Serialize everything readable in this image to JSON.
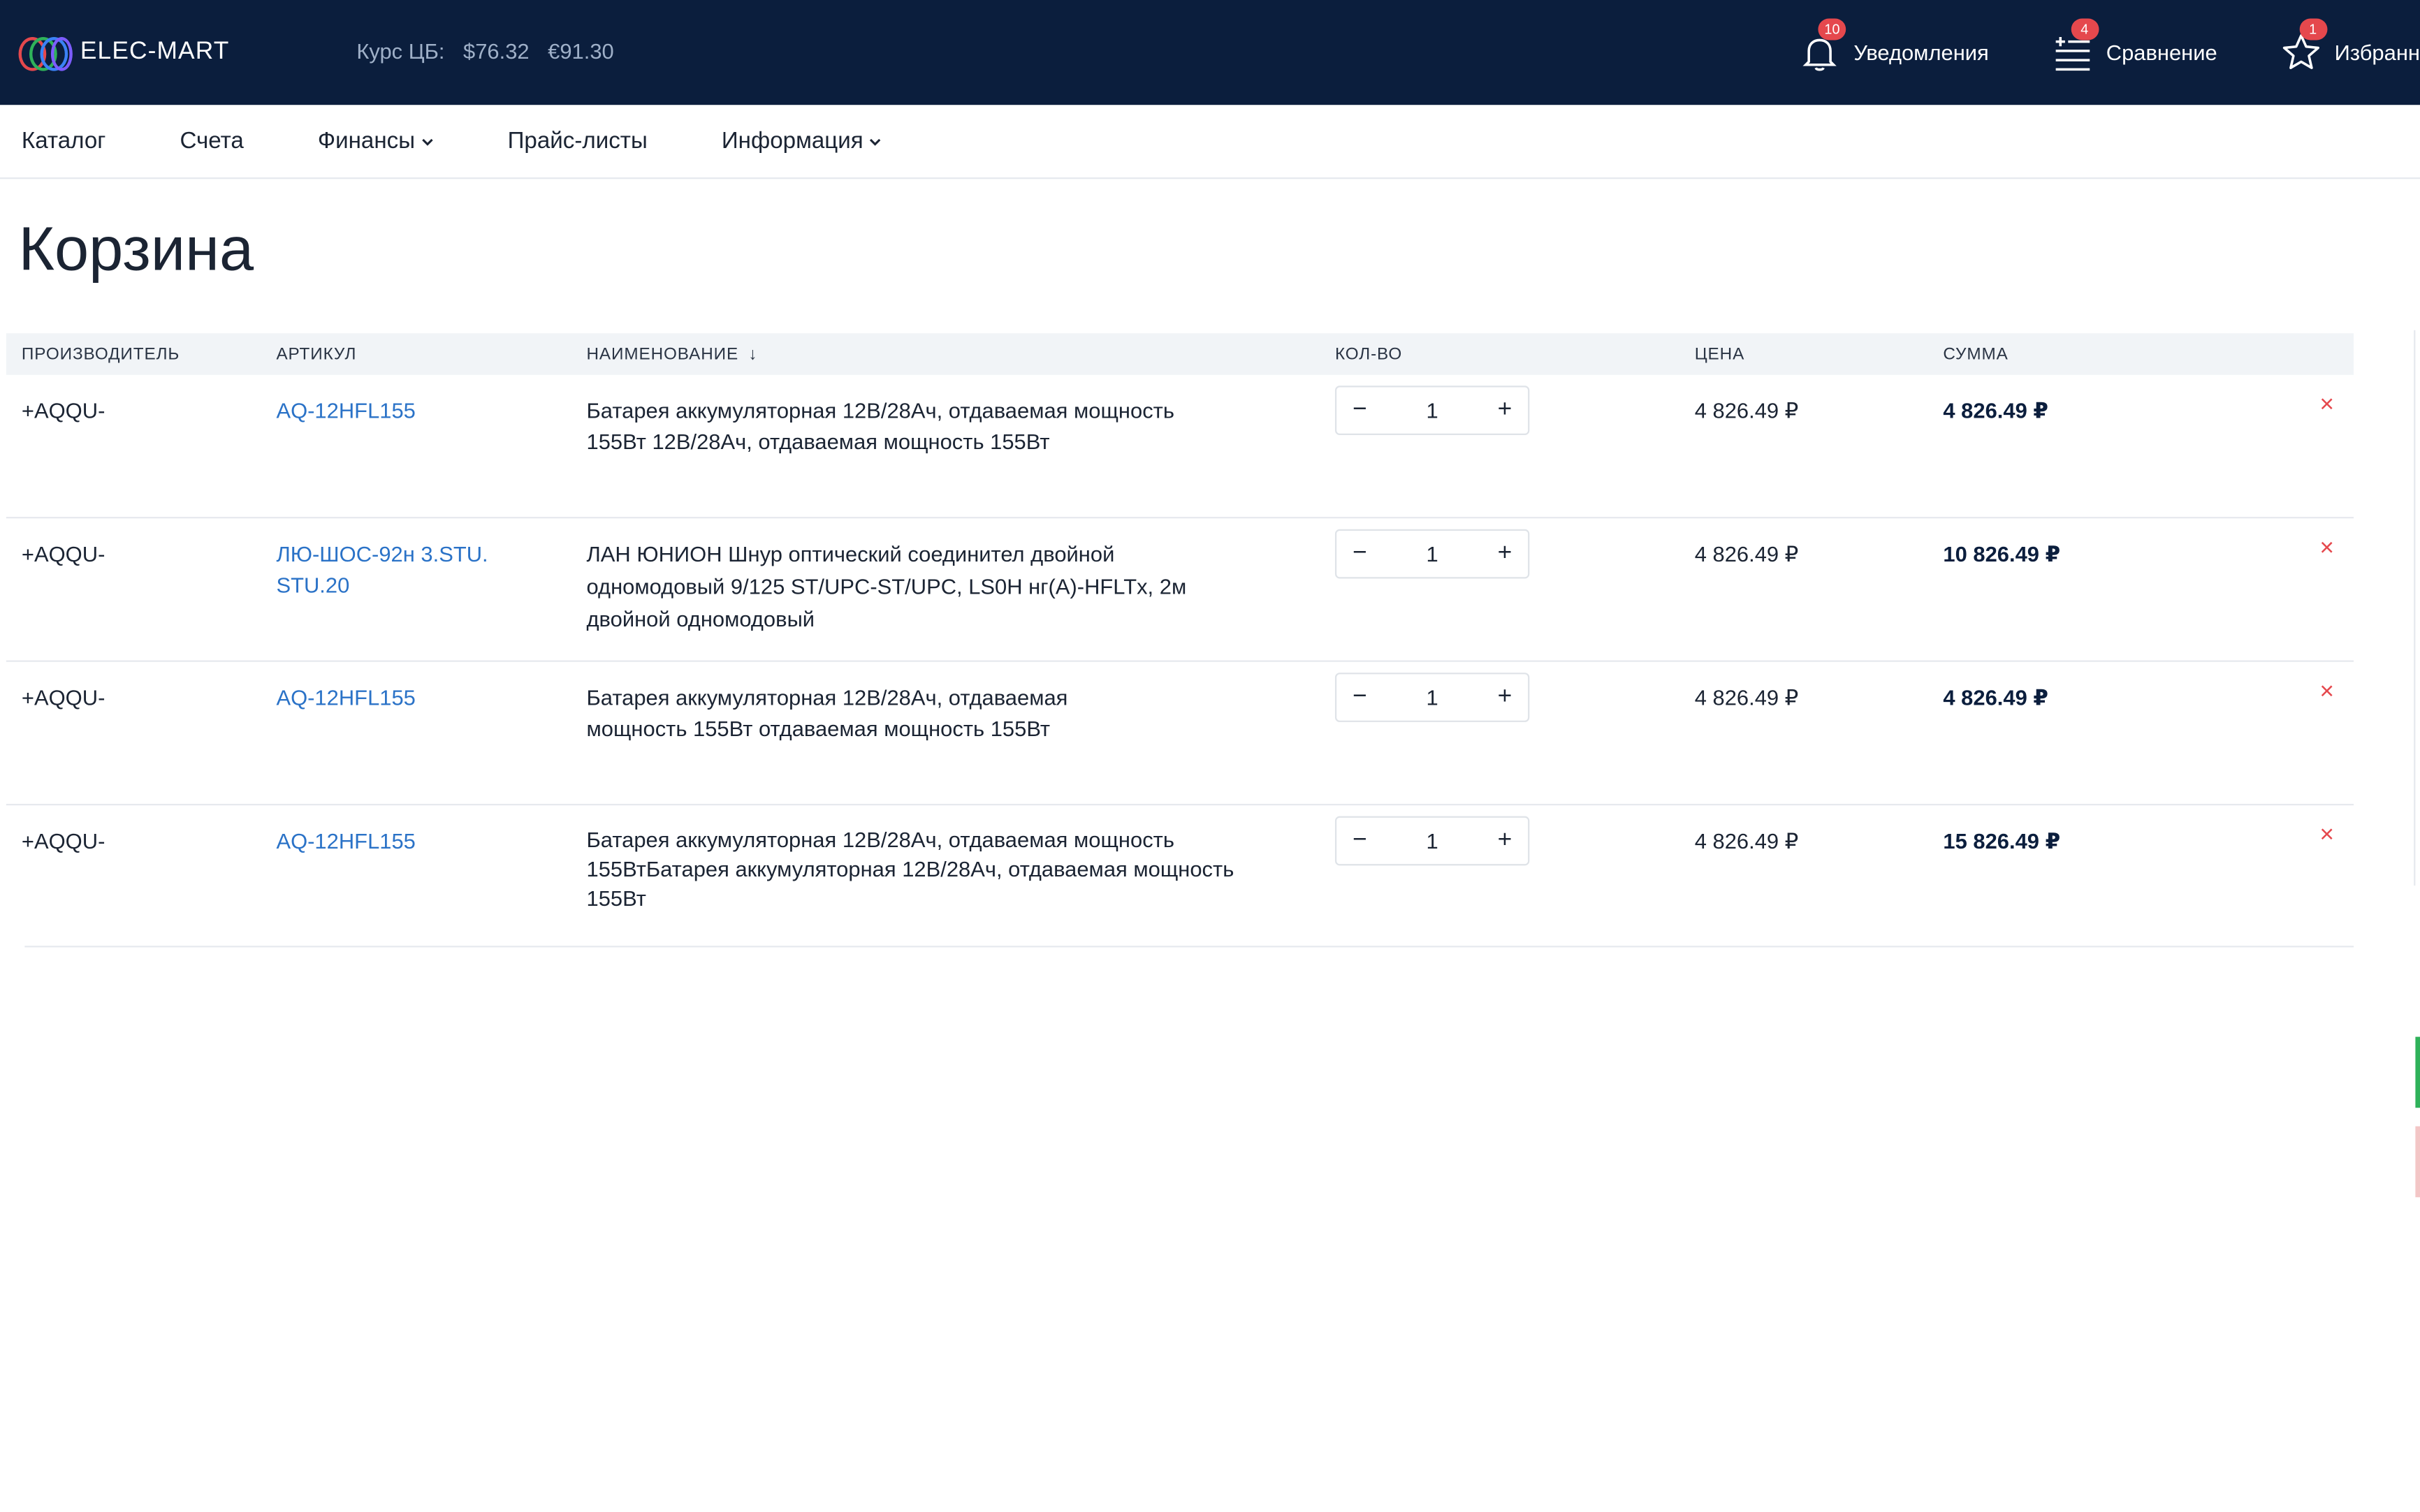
{
  "header": {
    "logo_text": "ELEC-MART",
    "rates_label": "Курс ЦБ:",
    "rate_usd": "$76.32",
    "rate_eur": "€91.30",
    "tools": [
      {
        "label": "Уведомления",
        "badge": "10",
        "icon": "bell-icon"
      },
      {
        "label": "Сравнение",
        "badge": "4",
        "icon": "compare-list-icon"
      },
      {
        "label": "Избранн",
        "badge": "1",
        "icon": "star-icon"
      }
    ]
  },
  "nav": {
    "items": [
      {
        "label": "Каталог",
        "dropdown": false
      },
      {
        "label": "Счета",
        "dropdown": false
      },
      {
        "label": "Финансы",
        "dropdown": true
      },
      {
        "label": "Прайс-листы",
        "dropdown": false
      },
      {
        "label": "Информация",
        "dropdown": true
      }
    ]
  },
  "page": {
    "title": "Корзина"
  },
  "table": {
    "columns": {
      "manufacturer": "ПРОИЗВОДИТЕЛЬ",
      "sku": "АРТИКУЛ",
      "name": "НАИМЕНОВАНИЕ",
      "name_sort": "↓",
      "qty": "КОЛ-ВО",
      "price": "ЦЕНА",
      "sum": "СУММА"
    },
    "rows": [
      {
        "manufacturer": "+AQQU-",
        "sku": "AQ-12HFL155",
        "name": "Батарея аккумуляторная 12В/28Ач, отдаваемая мощность 155Вт 12В/28Ач, отдаваемая мощность 155Вт",
        "qty": "1",
        "price": "4 826.49 ₽",
        "sum": "4 826.49 ₽"
      },
      {
        "manufacturer": "+AQQU-",
        "sku": "ЛЮ-ШОС-92н 3.STU. STU.20",
        "name": "ЛАН ЮНИОН Шнур оптический соединител двойной одномодовый 9/125 ST/UPC-ST/UPC, LS0H нг(А)-HFLTx, 2м двойной одномодовый",
        "qty": "1",
        "price": "4 826.49 ₽",
        "sum": "10 826.49 ₽"
      },
      {
        "manufacturer": "+AQQU-",
        "sku": "AQ-12HFL155",
        "name": "Батарея аккумуляторная 12В/28Ач, отдаваемая мощность 155Вт отдаваемая мощность 155Вт",
        "qty": "1",
        "price": "4 826.49 ₽",
        "sum": "4 826.49 ₽"
      },
      {
        "manufacturer": "+AQQU-",
        "sku": "AQ-12HFL155",
        "name": "Батарея аккумуляторная 12В/28Ач, отдаваемая мощность 155ВтБатарея аккумуляторная 12В/28Ач, отдаваемая мощность 155Вт",
        "qty": "1",
        "price": "4 826.49 ₽",
        "sum": "15 826.49 ₽"
      }
    ],
    "decrement": "−",
    "increment": "+",
    "delete": "×"
  },
  "colors": {
    "header_bg": "#0b1e3d",
    "link": "#2a72c7",
    "badge": "#e5484d",
    "delete": "#e5484d"
  }
}
